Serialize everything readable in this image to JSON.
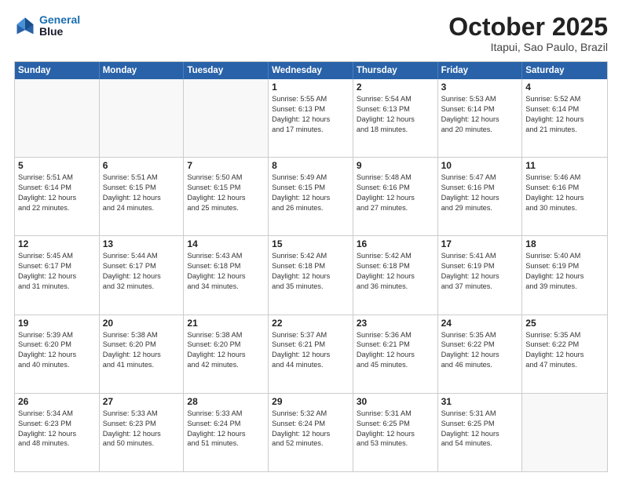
{
  "header": {
    "logo_line1": "General",
    "logo_line2": "Blue",
    "month": "October 2025",
    "location": "Itapui, Sao Paulo, Brazil"
  },
  "days_of_week": [
    "Sunday",
    "Monday",
    "Tuesday",
    "Wednesday",
    "Thursday",
    "Friday",
    "Saturday"
  ],
  "weeks": [
    [
      {
        "day": "",
        "empty": true
      },
      {
        "day": "",
        "empty": true
      },
      {
        "day": "",
        "empty": true
      },
      {
        "day": "1",
        "info": "Sunrise: 5:55 AM\nSunset: 6:13 PM\nDaylight: 12 hours\nand 17 minutes."
      },
      {
        "day": "2",
        "info": "Sunrise: 5:54 AM\nSunset: 6:13 PM\nDaylight: 12 hours\nand 18 minutes."
      },
      {
        "day": "3",
        "info": "Sunrise: 5:53 AM\nSunset: 6:14 PM\nDaylight: 12 hours\nand 20 minutes."
      },
      {
        "day": "4",
        "info": "Sunrise: 5:52 AM\nSunset: 6:14 PM\nDaylight: 12 hours\nand 21 minutes."
      }
    ],
    [
      {
        "day": "5",
        "info": "Sunrise: 5:51 AM\nSunset: 6:14 PM\nDaylight: 12 hours\nand 22 minutes."
      },
      {
        "day": "6",
        "info": "Sunrise: 5:51 AM\nSunset: 6:15 PM\nDaylight: 12 hours\nand 24 minutes."
      },
      {
        "day": "7",
        "info": "Sunrise: 5:50 AM\nSunset: 6:15 PM\nDaylight: 12 hours\nand 25 minutes."
      },
      {
        "day": "8",
        "info": "Sunrise: 5:49 AM\nSunset: 6:15 PM\nDaylight: 12 hours\nand 26 minutes."
      },
      {
        "day": "9",
        "info": "Sunrise: 5:48 AM\nSunset: 6:16 PM\nDaylight: 12 hours\nand 27 minutes."
      },
      {
        "day": "10",
        "info": "Sunrise: 5:47 AM\nSunset: 6:16 PM\nDaylight: 12 hours\nand 29 minutes."
      },
      {
        "day": "11",
        "info": "Sunrise: 5:46 AM\nSunset: 6:16 PM\nDaylight: 12 hours\nand 30 minutes."
      }
    ],
    [
      {
        "day": "12",
        "info": "Sunrise: 5:45 AM\nSunset: 6:17 PM\nDaylight: 12 hours\nand 31 minutes."
      },
      {
        "day": "13",
        "info": "Sunrise: 5:44 AM\nSunset: 6:17 PM\nDaylight: 12 hours\nand 32 minutes."
      },
      {
        "day": "14",
        "info": "Sunrise: 5:43 AM\nSunset: 6:18 PM\nDaylight: 12 hours\nand 34 minutes."
      },
      {
        "day": "15",
        "info": "Sunrise: 5:42 AM\nSunset: 6:18 PM\nDaylight: 12 hours\nand 35 minutes."
      },
      {
        "day": "16",
        "info": "Sunrise: 5:42 AM\nSunset: 6:18 PM\nDaylight: 12 hours\nand 36 minutes."
      },
      {
        "day": "17",
        "info": "Sunrise: 5:41 AM\nSunset: 6:19 PM\nDaylight: 12 hours\nand 37 minutes."
      },
      {
        "day": "18",
        "info": "Sunrise: 5:40 AM\nSunset: 6:19 PM\nDaylight: 12 hours\nand 39 minutes."
      }
    ],
    [
      {
        "day": "19",
        "info": "Sunrise: 5:39 AM\nSunset: 6:20 PM\nDaylight: 12 hours\nand 40 minutes."
      },
      {
        "day": "20",
        "info": "Sunrise: 5:38 AM\nSunset: 6:20 PM\nDaylight: 12 hours\nand 41 minutes."
      },
      {
        "day": "21",
        "info": "Sunrise: 5:38 AM\nSunset: 6:20 PM\nDaylight: 12 hours\nand 42 minutes."
      },
      {
        "day": "22",
        "info": "Sunrise: 5:37 AM\nSunset: 6:21 PM\nDaylight: 12 hours\nand 44 minutes."
      },
      {
        "day": "23",
        "info": "Sunrise: 5:36 AM\nSunset: 6:21 PM\nDaylight: 12 hours\nand 45 minutes."
      },
      {
        "day": "24",
        "info": "Sunrise: 5:35 AM\nSunset: 6:22 PM\nDaylight: 12 hours\nand 46 minutes."
      },
      {
        "day": "25",
        "info": "Sunrise: 5:35 AM\nSunset: 6:22 PM\nDaylight: 12 hours\nand 47 minutes."
      }
    ],
    [
      {
        "day": "26",
        "info": "Sunrise: 5:34 AM\nSunset: 6:23 PM\nDaylight: 12 hours\nand 48 minutes."
      },
      {
        "day": "27",
        "info": "Sunrise: 5:33 AM\nSunset: 6:23 PM\nDaylight: 12 hours\nand 50 minutes."
      },
      {
        "day": "28",
        "info": "Sunrise: 5:33 AM\nSunset: 6:24 PM\nDaylight: 12 hours\nand 51 minutes."
      },
      {
        "day": "29",
        "info": "Sunrise: 5:32 AM\nSunset: 6:24 PM\nDaylight: 12 hours\nand 52 minutes."
      },
      {
        "day": "30",
        "info": "Sunrise: 5:31 AM\nSunset: 6:25 PM\nDaylight: 12 hours\nand 53 minutes."
      },
      {
        "day": "31",
        "info": "Sunrise: 5:31 AM\nSunset: 6:25 PM\nDaylight: 12 hours\nand 54 minutes."
      },
      {
        "day": "",
        "empty": true
      }
    ]
  ]
}
